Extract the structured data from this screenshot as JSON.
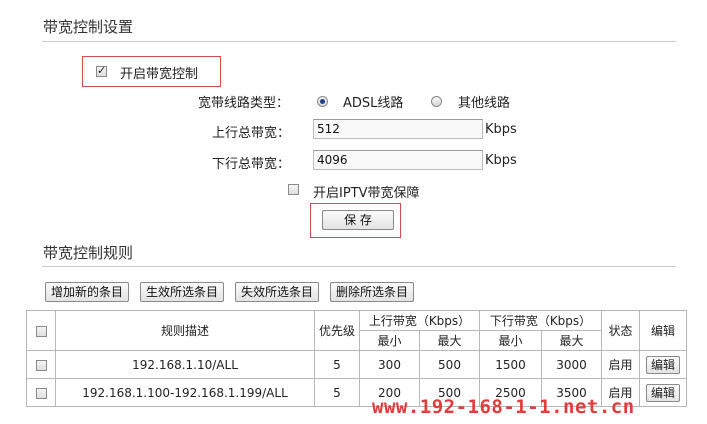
{
  "settings": {
    "title": "带宽控制设置",
    "enable_label": "开启带宽控制",
    "enable_checked": true,
    "line_type_label": "宽带线路类型：",
    "line_type_options": [
      "ADSL线路",
      "其他线路"
    ],
    "line_type_selected": "ADSL线路",
    "upload_label": "上行总带宽：",
    "upload_value": "512",
    "upload_unit": "Kbps",
    "download_label": "下行总带宽：",
    "download_value": "4096",
    "download_unit": "Kbps",
    "iptv_label": "开启IPTV带宽保障",
    "iptv_checked": false,
    "save_label": "保 存"
  },
  "rules": {
    "title": "带宽控制规则",
    "buttons": [
      "增加新的条目",
      "生效所选条目",
      "失效所选条目",
      "删除所选条目"
    ],
    "table": {
      "headers": {
        "description": "规则描述",
        "priority": "优先级",
        "upload": "上行带宽（Kbps）",
        "download": "下行带宽（Kbps）",
        "status": "状态",
        "edit": "编辑",
        "min": "最小",
        "max": "最大"
      },
      "rows": [
        {
          "description": "192.168.1.10/ALL",
          "priority": "5",
          "up_min": "300",
          "up_max": "500",
          "down_min": "1500",
          "down_max": "3000",
          "status": "启用",
          "edit": "编辑"
        },
        {
          "description": "192.168.1.100-192.168.1.199/ALL",
          "priority": "5",
          "up_min": "200",
          "up_max": "500",
          "down_min": "2500",
          "down_max": "3500",
          "status": "启用",
          "edit": "编辑"
        }
      ]
    }
  },
  "watermark": "www.192-168-1-1.net.cn"
}
